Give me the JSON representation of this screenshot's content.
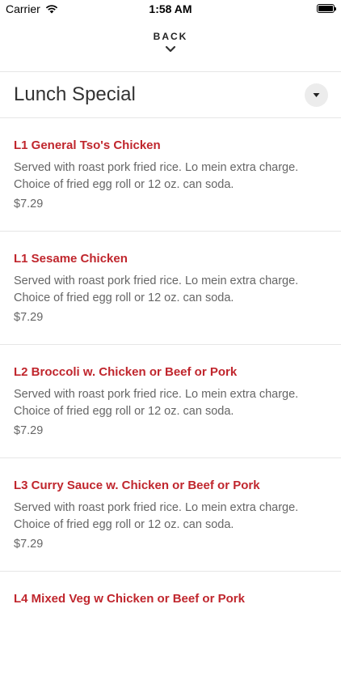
{
  "status_bar": {
    "carrier": "Carrier",
    "time": "1:58 AM"
  },
  "nav": {
    "back_label": "BACK"
  },
  "section": {
    "title": "Lunch Special"
  },
  "items": [
    {
      "name": "L1 General Tso's Chicken",
      "description": "Served with roast pork fried rice. Lo mein extra charge. Choice of fried egg roll or 12 oz. can soda.",
      "price": "$7.29"
    },
    {
      "name": "L1 Sesame Chicken",
      "description": "Served with roast pork fried rice. Lo mein extra charge. Choice of fried egg roll or 12 oz. can soda.",
      "price": "$7.29"
    },
    {
      "name": "L2 Broccoli w. Chicken or Beef or Pork",
      "description": "Served with roast pork fried rice. Lo mein extra charge. Choice of fried egg roll or 12 oz. can soda.",
      "price": "$7.29"
    },
    {
      "name": "L3 Curry Sauce w. Chicken or Beef or Pork",
      "description": "Served with roast pork fried rice. Lo mein extra charge. Choice of fried egg roll or 12 oz. can soda.",
      "price": "$7.29"
    },
    {
      "name": "L4 Mixed Veg w Chicken or Beef or Pork",
      "description": "",
      "price": ""
    }
  ],
  "colors": {
    "accent": "#c0262d",
    "text": "#333333",
    "muted": "#666666"
  },
  "icons": {
    "wifi": "wifi-icon",
    "battery": "battery-icon",
    "chevron": "chevron-down-icon",
    "dropdown": "caret-down-icon"
  }
}
